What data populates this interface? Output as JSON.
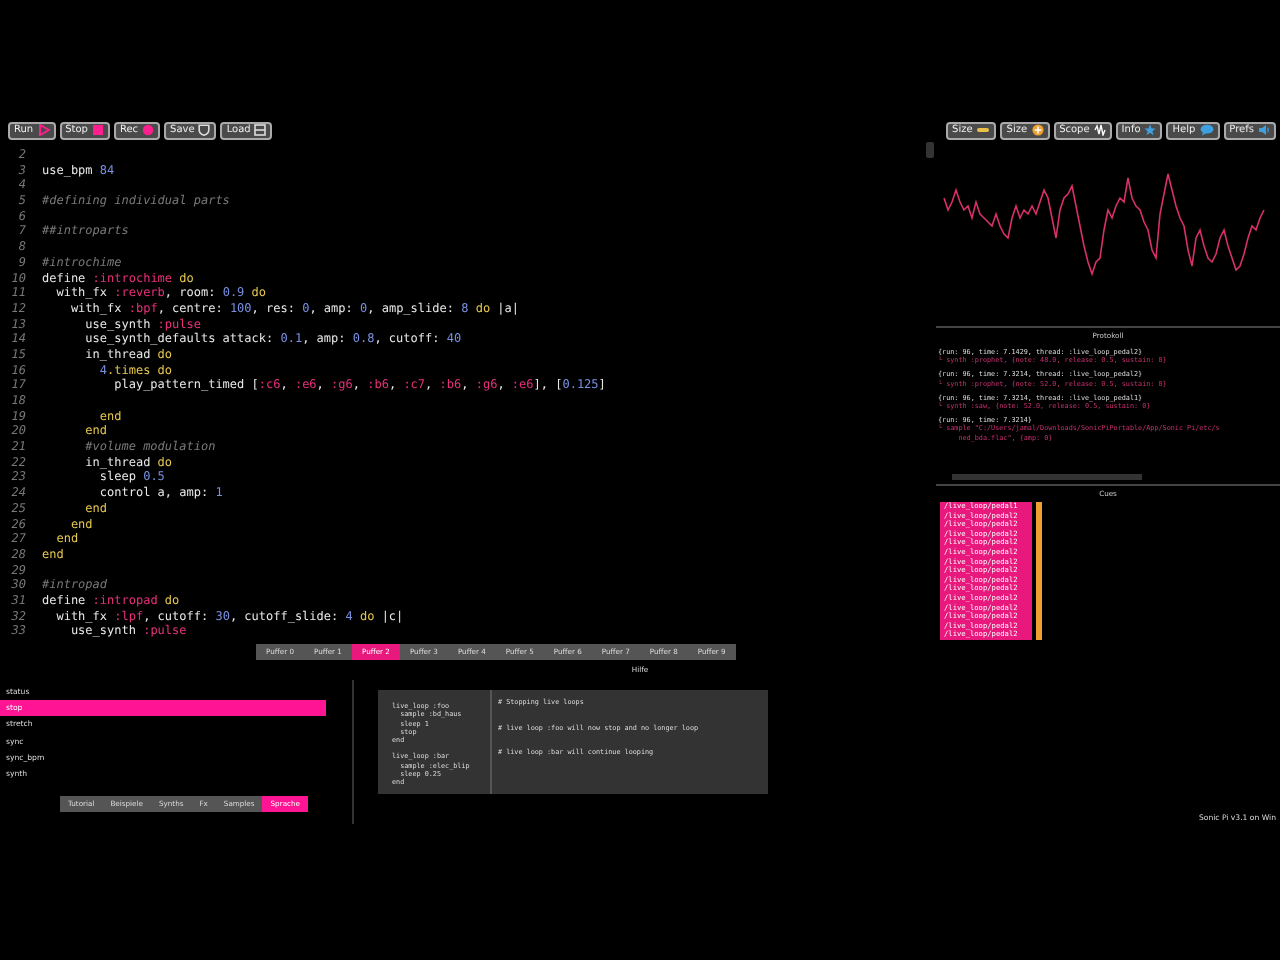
{
  "toolbar": {
    "left": [
      "Run",
      "Stop",
      "Rec",
      "Save",
      "Load"
    ],
    "right": [
      "Size",
      "Size",
      "Scope",
      "Info",
      "Help",
      "Prefs"
    ]
  },
  "editor": {
    "lines": [
      {
        "number": "2"
      },
      {
        "number": "3",
        "tokens": [
          {
            "kind": "plain",
            "text": "use_bpm "
          },
          {
            "kind": "number",
            "text": "84"
          }
        ]
      },
      {
        "number": "4"
      },
      {
        "number": "5",
        "tokens": [
          {
            "kind": "comment",
            "text": "#defining individual parts"
          }
        ]
      },
      {
        "number": "6"
      },
      {
        "number": "7",
        "tokens": [
          {
            "kind": "comment",
            "text": "##introparts"
          }
        ]
      },
      {
        "number": "8"
      },
      {
        "number": "9",
        "tokens": [
          {
            "kind": "comment",
            "text": "#introchime"
          }
        ]
      },
      {
        "number": "10",
        "tokens": [
          {
            "kind": "plain",
            "text": "define "
          },
          {
            "kind": "symbol",
            "text": ":introchime"
          },
          {
            "kind": "keyword",
            "text": " do"
          }
        ]
      },
      {
        "number": "11",
        "tokens": [
          {
            "kind": "plain",
            "text": "  with_fx "
          },
          {
            "kind": "symbol",
            "text": ":reverb"
          },
          {
            "kind": "plain",
            "text": ", room: "
          },
          {
            "kind": "number",
            "text": "0.9"
          },
          {
            "kind": "keyword",
            "text": " do"
          }
        ]
      },
      {
        "number": "12",
        "tokens": [
          {
            "kind": "plain",
            "text": "    with_fx "
          },
          {
            "kind": "symbol",
            "text": ":bpf"
          },
          {
            "kind": "plain",
            "text": ", centre: "
          },
          {
            "kind": "number",
            "text": "100"
          },
          {
            "kind": "plain",
            "text": ", res: "
          },
          {
            "kind": "number",
            "text": "0"
          },
          {
            "kind": "plain",
            "text": ", amp: "
          },
          {
            "kind": "number",
            "text": "0"
          },
          {
            "kind": "plain",
            "text": ", amp_slide: "
          },
          {
            "kind": "number",
            "text": "8"
          },
          {
            "kind": "keyword",
            "text": " do"
          },
          {
            "kind": "plain",
            "text": " |a|"
          }
        ]
      },
      {
        "number": "13",
        "tokens": [
          {
            "kind": "plain",
            "text": "      use_synth "
          },
          {
            "kind": "symbol",
            "text": ":pulse"
          }
        ]
      },
      {
        "number": "14",
        "tokens": [
          {
            "kind": "plain",
            "text": "      use_synth_defaults attack: "
          },
          {
            "kind": "number",
            "text": "0.1"
          },
          {
            "kind": "plain",
            "text": ", amp: "
          },
          {
            "kind": "number",
            "text": "0.8"
          },
          {
            "kind": "plain",
            "text": ", cutoff: "
          },
          {
            "kind": "number",
            "text": "40"
          }
        ]
      },
      {
        "number": "15",
        "tokens": [
          {
            "kind": "plain",
            "text": "      in_thread"
          },
          {
            "kind": "keyword",
            "text": " do"
          }
        ]
      },
      {
        "number": "16",
        "tokens": [
          {
            "kind": "number",
            "text": "        4"
          },
          {
            "kind": "keyword",
            "text": ".times do"
          }
        ]
      },
      {
        "number": "17",
        "tokens": [
          {
            "kind": "plain",
            "text": "          play_pattern_timed ["
          },
          {
            "kind": "symbol",
            "text": ":c6"
          },
          {
            "kind": "plain",
            "text": ", "
          },
          {
            "kind": "symbol",
            "text": ":e6"
          },
          {
            "kind": "plain",
            "text": ", "
          },
          {
            "kind": "symbol",
            "text": ":g6"
          },
          {
            "kind": "plain",
            "text": ", "
          },
          {
            "kind": "symbol",
            "text": ":b6"
          },
          {
            "kind": "plain",
            "text": ", "
          },
          {
            "kind": "symbol",
            "text": ":c7"
          },
          {
            "kind": "plain",
            "text": ", "
          },
          {
            "kind": "symbol",
            "text": ":b6"
          },
          {
            "kind": "plain",
            "text": ", "
          },
          {
            "kind": "symbol",
            "text": ":g6"
          },
          {
            "kind": "plain",
            "text": ", "
          },
          {
            "kind": "symbol",
            "text": ":e6"
          },
          {
            "kind": "plain",
            "text": "], ["
          },
          {
            "kind": "number",
            "text": "0.125"
          },
          {
            "kind": "plain",
            "text": "]"
          }
        ]
      },
      {
        "number": "18"
      },
      {
        "number": "19",
        "tokens": [
          {
            "kind": "keyword",
            "text": "        end"
          }
        ]
      },
      {
        "number": "20",
        "tokens": [
          {
            "kind": "keyword",
            "text": "      end"
          }
        ]
      },
      {
        "number": "21",
        "tokens": [
          {
            "kind": "comment",
            "text": "      #volume modulation"
          }
        ]
      },
      {
        "number": "22",
        "tokens": [
          {
            "kind": "plain",
            "text": "      in_thread"
          },
          {
            "kind": "keyword",
            "text": " do"
          }
        ]
      },
      {
        "number": "23",
        "tokens": [
          {
            "kind": "plain",
            "text": "        sleep "
          },
          {
            "kind": "number",
            "text": "0.5"
          }
        ]
      },
      {
        "number": "24",
        "tokens": [
          {
            "kind": "plain",
            "text": "        control a, amp: "
          },
          {
            "kind": "number",
            "text": "1"
          }
        ]
      },
      {
        "number": "25",
        "tokens": [
          {
            "kind": "keyword",
            "text": "      end"
          }
        ]
      },
      {
        "number": "26",
        "tokens": [
          {
            "kind": "keyword",
            "text": "    end"
          }
        ]
      },
      {
        "number": "27",
        "tokens": [
          {
            "kind": "keyword",
            "text": "  end"
          }
        ]
      },
      {
        "number": "28",
        "tokens": [
          {
            "kind": "keyword",
            "text": "end"
          }
        ]
      },
      {
        "number": "29"
      },
      {
        "number": "30",
        "tokens": [
          {
            "kind": "comment",
            "text": "#intropad"
          }
        ]
      },
      {
        "number": "31",
        "tokens": [
          {
            "kind": "plain",
            "text": "define "
          },
          {
            "kind": "symbol",
            "text": ":intropad"
          },
          {
            "kind": "keyword",
            "text": " do"
          }
        ]
      },
      {
        "number": "32",
        "tokens": [
          {
            "kind": "plain",
            "text": "  with_fx "
          },
          {
            "kind": "symbol",
            "text": ":lpf"
          },
          {
            "kind": "plain",
            "text": ", cutoff: "
          },
          {
            "kind": "number",
            "text": "30"
          },
          {
            "kind": "plain",
            "text": ", cutoff_slide: "
          },
          {
            "kind": "number",
            "text": "4"
          },
          {
            "kind": "keyword",
            "text": " do"
          },
          {
            "kind": "plain",
            "text": " |c|"
          }
        ]
      },
      {
        "number": "33",
        "tokens": [
          {
            "kind": "plain",
            "text": "    use_synth "
          },
          {
            "kind": "symbol",
            "text": ":pulse"
          }
        ]
      }
    ]
  },
  "log": {
    "title": "Protokoll",
    "entries": [
      {
        "header": "{run: 96, time: 7.1429, thread: :live_loop_pedal2}",
        "details": [
          "└ synth :prophet, {note: 48.0, release: 0.5, sustain: 0}"
        ]
      },
      {
        "header": "{run: 96, time: 7.3214, thread: :live_loop_pedal2}",
        "details": [
          "└ synth :prophet, {note: 52.0, release: 0.5, sustain: 0}"
        ]
      },
      {
        "header": "{run: 96, time: 7.3214, thread: :live_loop_pedal1}",
        "details": [
          "└ synth :saw, {note: 52.0, release: 0.5, sustain: 0}"
        ]
      },
      {
        "header": "{run: 96, time: 7.3214}",
        "details": [
          "└ sample \"C:/Users/jamal/Downloads/SonicPiPortable/App/Sonic Pi/etc/s",
          "     ned_bda.flac\", {amp: 0}"
        ]
      }
    ]
  },
  "cues": {
    "title": "Cues",
    "items": [
      "/live_loop/pedal1",
      "/live_loop/pedal2",
      "/live_loop/pedal2",
      "/live_loop/pedal2",
      "/live_loop/pedal2",
      "/live_loop/pedal2",
      "/live_loop/pedal2",
      "/live_loop/pedal2",
      "/live_loop/pedal2",
      "/live_loop/pedal2",
      "/live_loop/pedal2",
      "/live_loop/pedal2",
      "/live_loop/pedal2",
      "/live_loop/pedal2",
      "/live_loop/pedal2"
    ]
  },
  "buffers": [
    {
      "label": "Puffer 0",
      "selected": false
    },
    {
      "label": "Puffer 1",
      "selected": false
    },
    {
      "label": "Puffer 2",
      "selected": true
    },
    {
      "label": "Puffer 3",
      "selected": false
    },
    {
      "label": "Puffer 4",
      "selected": false
    },
    {
      "label": "Puffer 5",
      "selected": false
    },
    {
      "label": "Puffer 6",
      "selected": false
    },
    {
      "label": "Puffer 7",
      "selected": false
    },
    {
      "label": "Puffer 8",
      "selected": false
    },
    {
      "label": "Puffer 9",
      "selected": false
    }
  ],
  "help": {
    "title": "Hilfe",
    "items": [
      {
        "label": "status",
        "selected": false
      },
      {
        "label": "stop",
        "selected": true
      },
      {
        "label": "stretch",
        "selected": false
      },
      {
        "label": "sync",
        "selected": false
      },
      {
        "label": "sync_bpm",
        "selected": false
      },
      {
        "label": "synth",
        "selected": false
      }
    ],
    "tabs": [
      {
        "label": "Tutorial",
        "selected": false
      },
      {
        "label": "Beispiele",
        "selected": false
      },
      {
        "label": "Synths",
        "selected": false
      },
      {
        "label": "Fx",
        "selected": false
      },
      {
        "label": "Samples",
        "selected": false
      },
      {
        "label": "Sprache",
        "selected": true
      }
    ],
    "example": {
      "code": "\nlive_loop :foo\n  sample :bd_haus\n  sleep 1\n  stop\nend\n\nlive_loop :bar\n  sample :elec_blip\n  sleep 0.25\nend",
      "comments": [
        "# Stopping live loops",
        "# live loop :foo will now stop and no longer loop",
        "# live loop :bar will continue looping"
      ]
    }
  },
  "status_bar": "Sonic Pi v3.1 on Win"
}
